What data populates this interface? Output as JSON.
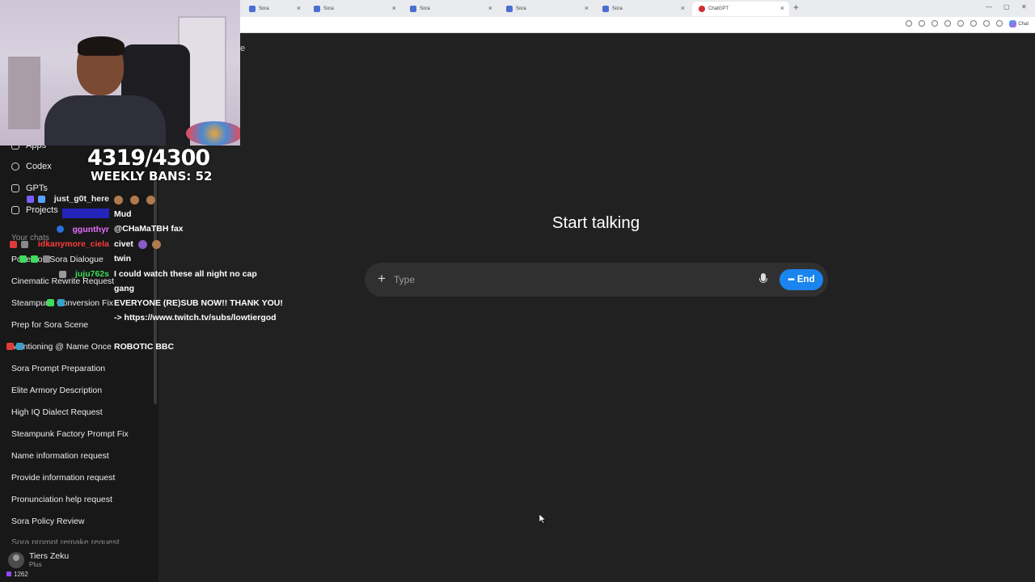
{
  "browser": {
    "tabs": [
      {
        "label": "Sora"
      },
      {
        "label": "Sora"
      },
      {
        "label": "Sora"
      },
      {
        "label": "Sora"
      },
      {
        "label": "ChatGPT",
        "active": true
      }
    ],
    "new_tab": "+",
    "close": "×",
    "copilot_label": "Chat"
  },
  "sidebar": {
    "nav": [
      {
        "label": "Apps",
        "icon": "apps-icon"
      },
      {
        "label": "Codex",
        "icon": "codex-icon"
      },
      {
        "label": "GPTs",
        "icon": "gpts-icon"
      },
      {
        "label": "Projects",
        "icon": "projects-icon"
      }
    ],
    "section_label": "Your chats",
    "chats": [
      "Pokemon Sora Dialogue",
      "Cinematic Rewrite Request",
      "Steampunk Conversion Fix",
      "Prep for Sora Scene",
      "Mentioning @ Name Once",
      "Sora Prompt Preparation",
      "Elite Armory Description",
      "High IQ Dialect Request",
      "Steampunk Factory Prompt Fix",
      "Name information request",
      "Provide information request",
      "Pronunciation help request",
      "Sora Policy Review",
      "Sora prompt remake request"
    ],
    "user": {
      "name": "Tiers Zeku",
      "plan": "Plus"
    }
  },
  "overlay": {
    "counter": "4319/4300",
    "weekly_bans": "WEEKLY BANS: 52",
    "viewer_count": "1262",
    "chat": [
      {
        "user": "just_g0t_here",
        "color": "#8a5cff",
        "message": ""
      },
      {
        "user": "",
        "color": "#2a2aff",
        "message": "Mud"
      },
      {
        "user": "ggunthyr",
        "color": "#e86cff",
        "message": "@CHaMaTBH fax"
      },
      {
        "user": "idkanymore_ciela",
        "color": "#ff3b3b",
        "message": "civet"
      },
      {
        "user": "",
        "color": "#555577",
        "message": "twin"
      },
      {
        "user": "juju762s",
        "color": "#3ddc5a",
        "message": "I could watch these all night no cap gang"
      },
      {
        "user": "",
        "color": "#5a5aff",
        "message": "EVERYONE (RE)SUB NOW!! THANK YOU! -> https://www.twitch.tv/subs/lowtiergod"
      },
      {
        "user": "",
        "color": "#5555cc",
        "message": "ROBOTIC BBC"
      }
    ]
  },
  "main": {
    "partial_text": "e",
    "heading": "Start talking",
    "composer": {
      "placeholder": "Type",
      "end_label": "End"
    }
  },
  "colors": {
    "accent": "#1a84ef",
    "background": "#212121",
    "sidebar": "#181818",
    "composer": "#303030"
  }
}
